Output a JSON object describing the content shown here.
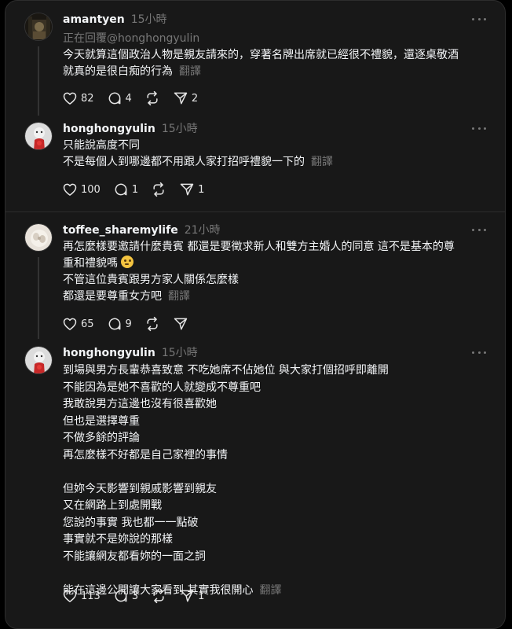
{
  "icons": {
    "like": "heart-icon",
    "reply": "comment-icon",
    "repost": "repost-icon",
    "share": "send-icon",
    "more": "more-icon"
  },
  "translate_label": "翻譯",
  "posts": [
    {
      "username": "amantyen",
      "time": "15小時",
      "reply_to": "正在回覆@honghongyulin",
      "lines": [
        "今天就算這個政治人物是親友請來的，穿著名牌出席就已經很不禮貌，還逐桌敬酒",
        "就真的是很白痴的行為"
      ],
      "likes": "82",
      "replies": "4",
      "reposts": "",
      "shares": "2"
    },
    {
      "username": "honghongyulin",
      "time": "15小時",
      "lines": [
        "只能說高度不同",
        "不是每個人到哪邊都不用跟人家打招呼禮貌一下的"
      ],
      "likes": "100",
      "replies": "1",
      "reposts": "",
      "shares": "1"
    },
    {
      "username": "toffee_sharemylife",
      "time": "21小時",
      "lines": [
        "再怎麼樣要邀請什麼貴賓 都還是要徵求新人和雙方主婚人的同意 這不是基本的尊",
        "重和禮貌嗎",
        "不管這位貴賓跟男方家人關係怎麼樣",
        "都還是要尊重女方吧"
      ],
      "likes": "65",
      "replies": "9",
      "reposts": "",
      "shares": ""
    },
    {
      "username": "honghongyulin",
      "time": "15小時",
      "lines": [
        "到場與男方長輩恭喜致意 不吃她席不佔她位 與大家打個招呼即離開",
        "不能因為是她不喜歡的人就變成不尊重吧",
        "我敢說男方這邊也沒有很喜歡她",
        "但也是選擇尊重",
        "不做多餘的評論",
        "再怎麼樣不好都是自己家裡的事情",
        "",
        "但妳今天影響到親戚影響到親友",
        "又在網路上到處開戰",
        "您說的事實 我也都一一點破",
        "事實就不是妳說的那樣",
        "不能讓網友都看妳的一面之詞",
        "",
        "能在這邊公開讓大家看到 其實我很開心"
      ],
      "likes": "113",
      "replies": "3",
      "reposts": "",
      "shares": "1"
    }
  ]
}
